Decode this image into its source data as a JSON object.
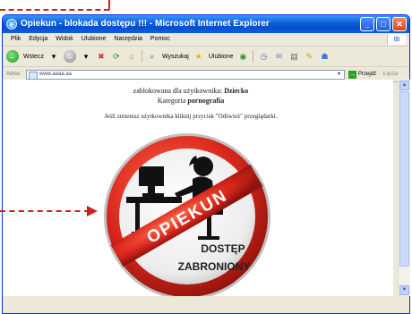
{
  "window": {
    "title": "Opiekun - blokada dostępu !!! - Microsoft Internet Explorer",
    "controls": [
      "minimize",
      "maximize",
      "close"
    ]
  },
  "menu": {
    "items": [
      "Plik",
      "Edycja",
      "Widok",
      "Ulubione",
      "Narzędzia",
      "Pomoc"
    ]
  },
  "toolbar": {
    "back_label": "Wstecz",
    "search_label": "Wyszukaj",
    "favorites_label": "Ulubione"
  },
  "address": {
    "label": "Adres",
    "value": "www.aaaa.aa",
    "go_label": "Przejdź",
    "links_label": "Łącza"
  },
  "page": {
    "blocked_prefix": "zablokowana dla użytkownika:",
    "blocked_user": "Dziecko",
    "category_prefix": "Kategoria",
    "category_value": "pornografia",
    "refresh_hint": "Jeśli zmienisz użytkownika kliknij przycisk \"Odśwież\" przeglądarki."
  },
  "sign": {
    "brand": "OPIEKUN",
    "line1": "DOSTĘP",
    "line2": "ZABRONIONY"
  },
  "colors": {
    "annotation": "#cc2020",
    "sign_red": "#d9261c",
    "titlebar_blue": "#0a5fd8"
  }
}
